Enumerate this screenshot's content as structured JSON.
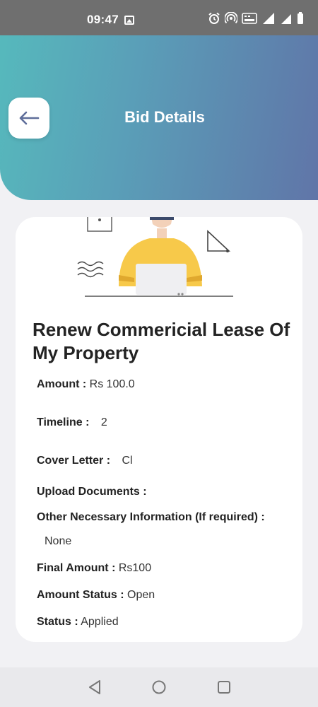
{
  "status_bar": {
    "time": "09:47",
    "icons": [
      "image-icon",
      "alarm-icon",
      "hotspot-icon",
      "volte-icon",
      "signal-4g-icon",
      "signal-icon",
      "battery-icon"
    ]
  },
  "header": {
    "title": "Bid Details",
    "back_icon": "arrow-left-icon"
  },
  "bid": {
    "title": "Renew Commericial Lease Of My Property",
    "amount_label": "Amount :",
    "amount_value": "Rs 100.0",
    "timeline_label": "Timeline :",
    "timeline_value": "2",
    "cover_letter_label": "Cover Letter :",
    "cover_letter_value": "Cl",
    "upload_documents_label": "Upload Documents :",
    "other_info_label": "Other Necessary Information (If required) :",
    "other_info_value": "None",
    "final_amount_label": "Final Amount :",
    "final_amount_value": "Rs100",
    "amount_status_label": "Amount Status :",
    "amount_status_value": "Open",
    "status_label": "Status :",
    "status_value": "Applied"
  },
  "colors": {
    "header_gradient_start": "#56b9bc",
    "header_gradient_end": "#6075a8",
    "illustration_yellow": "#f7c94a"
  },
  "navbar": {
    "buttons": [
      "back-triangle-icon",
      "home-circle-icon",
      "recents-square-icon"
    ]
  }
}
